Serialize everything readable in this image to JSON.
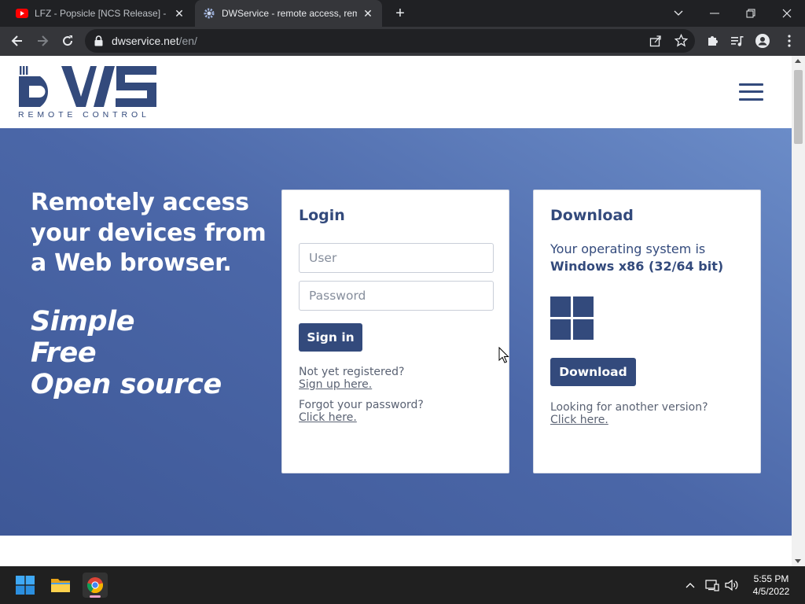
{
  "browser": {
    "tabs": [
      {
        "title": "LFZ - Popsicle [NCS Release] - Yo",
        "active": false,
        "favicon": "youtube-icon"
      },
      {
        "title": "DWService - remote access, remo",
        "active": true,
        "favicon": "dwservice-gear-icon"
      }
    ],
    "address_bar": {
      "domain": "dwservice.net",
      "path": "/en/"
    }
  },
  "site": {
    "logo": {
      "wordmark": "DWS",
      "tagline": "REMOTE CONTROL"
    },
    "hero": {
      "headline": "Remotely access your devices from a Web browser.",
      "taglines": [
        "Simple",
        "Free",
        "Open source"
      ]
    },
    "login": {
      "title": "Login",
      "user_placeholder": "User",
      "password_placeholder": "Password",
      "signin_label": "Sign in",
      "register_prompt": "Not yet registered?",
      "register_link": "Sign up here.",
      "forgot_prompt": "Forgot your password?",
      "forgot_link": "Click here."
    },
    "download": {
      "title": "Download",
      "os_prefix": "Your operating system is",
      "os_name": "Windows x86 (32/64 bit)",
      "os_icon": "windows-icon",
      "button_label": "Download",
      "other_prompt": "Looking for another version?",
      "other_link": "Click here."
    }
  },
  "taskbar": {
    "apps": [
      "windows-start-icon",
      "file-explorer-icon",
      "chrome-icon"
    ],
    "clock": {
      "time": "5:55 PM",
      "date": "4/5/2022"
    }
  },
  "colors": {
    "brand": "#334a7c",
    "hero_gradient_start": "#3e5897",
    "hero_gradient_end": "#6b8cc8"
  }
}
